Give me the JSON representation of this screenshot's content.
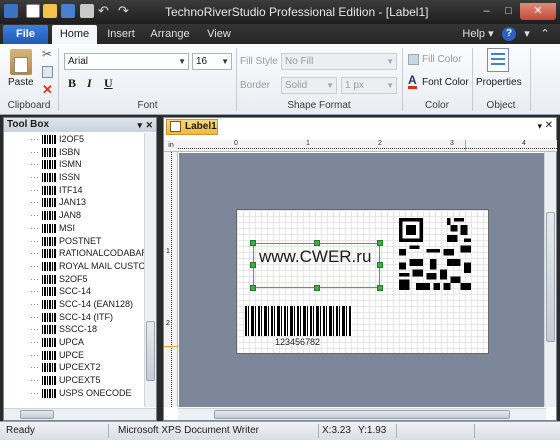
{
  "window": {
    "title": "TechnoRiverStudio Professional Edition - [Label1]"
  },
  "window_buttons": {
    "minimize": "–",
    "maximize": "□",
    "close": "✕"
  },
  "ribbon": {
    "file_label": "File",
    "tabs": [
      "Home",
      "Insert",
      "Arrange",
      "View"
    ],
    "help_label": "Help",
    "clipboard": {
      "paste_label": "Paste",
      "group_label": "Clipboard"
    },
    "font": {
      "family": "Arial",
      "size": "16",
      "group_label": "Font",
      "bold": "B",
      "italic": "I",
      "underline": "U"
    },
    "shape_format": {
      "fill_style_label": "Fill Style",
      "fill_style_value": "No Fill",
      "border_label": "Border",
      "border_value": "Solid",
      "border_width": "1 px",
      "group_label": "Shape Format"
    },
    "color": {
      "fill_color_label": "Fill Color",
      "font_color_label": "Font Color",
      "group_label": "Color"
    },
    "object": {
      "properties_label": "Properties",
      "group_label": "Object"
    }
  },
  "toolbox": {
    "title": "Tool Box",
    "items": [
      "I2OF5",
      "ISBN",
      "ISMN",
      "ISSN",
      "ITF14",
      "JAN13",
      "JAN8",
      "MSI",
      "POSTNET",
      "RATIONALCODABAR",
      "ROYAL MAIL CUSTOM",
      "S2OF5",
      "SCC-14",
      "SCC-14 (EAN128)",
      "SCC-14 (ITF)",
      "SSCC-18",
      "UPCA",
      "UPCE",
      "UPCEXT2",
      "UPCEXT5",
      "USPS ONECODE"
    ]
  },
  "document": {
    "tab_label": "Label1",
    "ruler_unit": "in",
    "ruler_marks": [
      "0",
      "1",
      "2",
      "3",
      "4"
    ],
    "ruler_left_marks": [
      "1",
      "2"
    ],
    "text_object": "www.CWER.ru",
    "barcode_text": "123456782"
  },
  "status": {
    "state": "Ready",
    "printer": "Microsoft XPS Document Writer",
    "x": "X:3.23",
    "y": "Y:1.93"
  },
  "colors": {
    "accent": "#2a62c0",
    "selection": "#3cb043",
    "canvas": "#7c8799",
    "doc_tab": "#f5b93c"
  },
  "icons": [
    "app-icon",
    "new-icon",
    "open-icon",
    "save-icon",
    "print-icon",
    "undo-icon",
    "redo-icon",
    "paste-icon",
    "cut-icon",
    "copy-icon",
    "delete-icon",
    "bold-icon",
    "italic-icon",
    "underline-icon",
    "fill-color-icon",
    "font-color-icon",
    "properties-icon",
    "help-icon",
    "barcode-icon"
  ]
}
